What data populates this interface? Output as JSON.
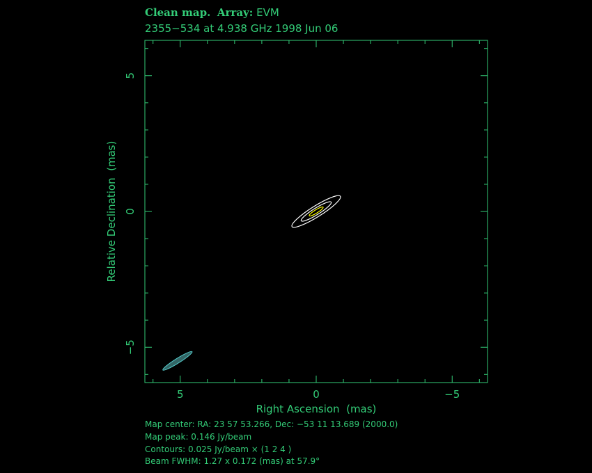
{
  "header": {
    "title_prefix": "Clean map.",
    "array_label": "Array:",
    "array_value": "EVM",
    "subtitle": "2355−534 at 4.938 GHz 1998 Jun 06"
  },
  "footer": {
    "map_center": "Map center:  RA: 23 57 53.266,  Dec: −53 11 13.689 (2000.0)",
    "map_peak": "Map peak: 0.146 Jy/beam",
    "contours": "Contours: 0.025 Jy/beam × (1 2 4 )",
    "beam": "Beam FWHM: 1.27 x 0.172 (mas) at 57.9°"
  },
  "colors": {
    "axes": "#33cc77",
    "contour": "#ffffff",
    "peak_contour": "#ffff00",
    "beam_fill": "#336666",
    "beam_edge": "#55cccc",
    "background": "#000000"
  },
  "chart_data": {
    "type": "contour",
    "xlabel": "Right Ascension  (mas)",
    "ylabel": "Relative Declination  (mas)",
    "xlim": [
      6.3,
      -6.3
    ],
    "ylim": [
      -6.3,
      6.3
    ],
    "x_ticks": [
      5,
      0,
      -5
    ],
    "x_tick_labels": [
      "5",
      "0",
      "−5"
    ],
    "y_ticks": [
      5,
      0,
      -5
    ],
    "y_tick_labels": [
      "5",
      "0",
      "−5"
    ],
    "grid": false,
    "contour_base_jy_per_beam": 0.025,
    "contour_multipliers": [
      1,
      2,
      4
    ],
    "peak_jy_per_beam": 0.146,
    "contours": [
      {
        "level": 1,
        "center": [
          0.0,
          0.0
        ],
        "half_length_mas": 1.05,
        "half_width_mas": 0.2,
        "pa_deg": 57.9
      },
      {
        "level": 2,
        "center": [
          0.0,
          0.0
        ],
        "half_length_mas": 0.65,
        "half_width_mas": 0.12,
        "pa_deg": 57.9
      },
      {
        "level": 4,
        "center": [
          0.0,
          0.0
        ],
        "half_length_mas": 0.3,
        "half_width_mas": 0.06,
        "pa_deg": 57.9
      }
    ],
    "beam": {
      "center": [
        5.1,
        -5.5
      ],
      "major_mas": 1.27,
      "minor_mas": 0.172,
      "pa_deg": 57.9
    }
  }
}
